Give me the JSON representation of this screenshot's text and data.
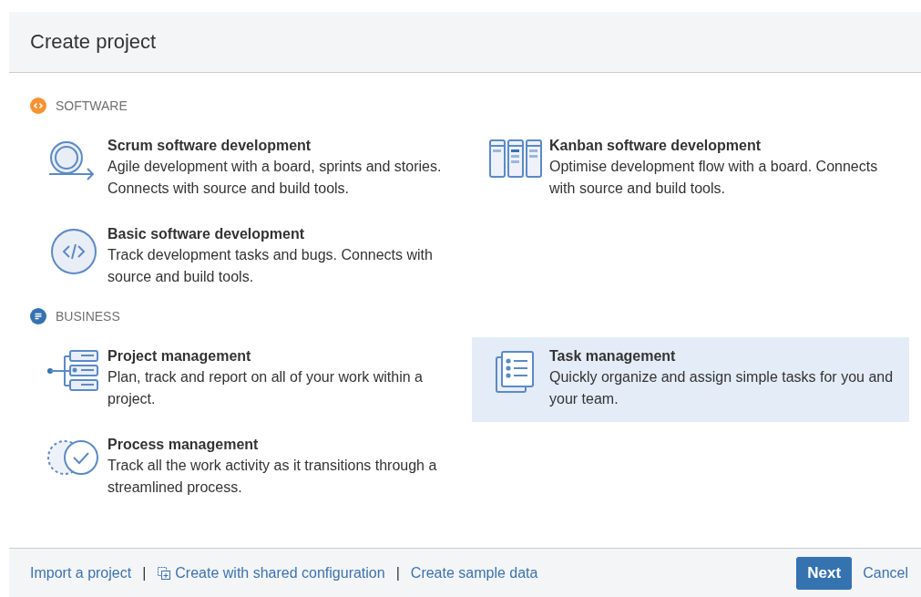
{
  "dialog": {
    "title": "Create project"
  },
  "sections": [
    {
      "kind": "software",
      "heading": "SOFTWARE",
      "templates": [
        {
          "kind": "scrum",
          "title": "Scrum software development",
          "description": "Agile development with a board, sprints and stories. Connects with source and build tools.",
          "selected": false
        },
        {
          "kind": "kanban",
          "title": "Kanban software development",
          "description": "Optimise development flow with a board. Connects with source and build tools.",
          "selected": false
        },
        {
          "kind": "basic",
          "title": "Basic software development",
          "description": "Track development tasks and bugs. Connects with source and build tools.",
          "selected": false
        }
      ]
    },
    {
      "kind": "business",
      "heading": "BUSINESS",
      "templates": [
        {
          "kind": "project",
          "title": "Project management",
          "description": "Plan, track and report on all of your work within a project.",
          "selected": false
        },
        {
          "kind": "task",
          "title": "Task management",
          "description": "Quickly organize and assign simple tasks for you and your team.",
          "selected": true
        },
        {
          "kind": "process",
          "title": "Process management",
          "description": "Track all the work activity as it transitions through a streamlined process.",
          "selected": false
        }
      ]
    }
  ],
  "footer": {
    "links": [
      {
        "kind": "plain",
        "label": "Import a project"
      },
      {
        "kind": "shared",
        "label": "Create with shared configuration"
      },
      {
        "kind": "plain",
        "label": "Create sample data"
      }
    ],
    "separator": "|",
    "primary_button": "Next",
    "cancel_link": "Cancel"
  }
}
